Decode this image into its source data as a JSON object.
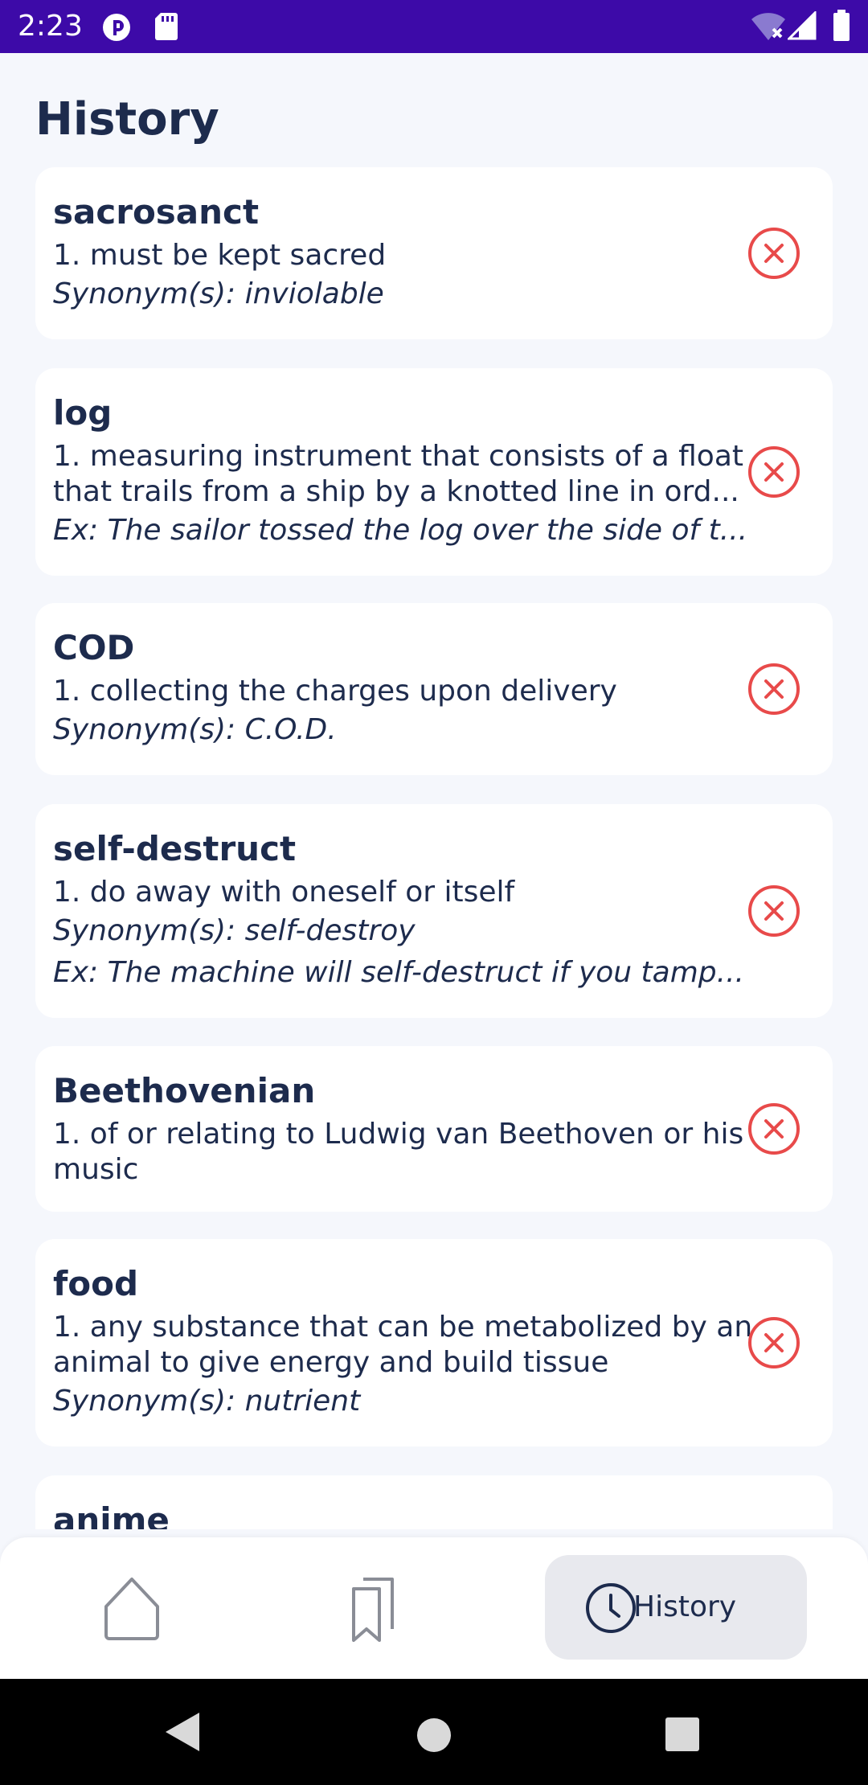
{
  "status_bar": {
    "time": "2:23",
    "icons": [
      "pocket-casts-icon",
      "sd-card-icon",
      "wifi-off-icon",
      "signal-icon",
      "battery-icon"
    ]
  },
  "page": {
    "title": "History"
  },
  "entries": [
    {
      "word": "sacrosanct",
      "definition": "1. must be kept sacred",
      "synonyms": "Synonym(s): inviolable",
      "example": ""
    },
    {
      "word": "log",
      "definition": "1. measuring instrument that consists of a float that trails from a ship by a knotted line in ord...",
      "synonyms": "",
      "example": "Ex: The sailor tossed the log over the side of t..."
    },
    {
      "word": "COD",
      "definition": "1. collecting the charges upon delivery",
      "synonyms": "Synonym(s): C.O.D.",
      "example": ""
    },
    {
      "word": "self-destruct",
      "definition": "1. do away with oneself or itself",
      "synonyms": "Synonym(s): self-destroy",
      "example": "Ex: The machine will self-destruct if you tamp..."
    },
    {
      "word": "Beethovenian",
      "definition": "1. of or relating to Ludwig van Beethoven or his music",
      "synonyms": "",
      "example": ""
    },
    {
      "word": "food",
      "definition": "1. any substance that can be metabolized by an animal to give energy and build tissue",
      "synonyms": "Synonym(s): nutrient",
      "example": ""
    },
    {
      "word": "anime",
      "definition": "",
      "synonyms": "",
      "example": ""
    }
  ],
  "bottom_nav": {
    "items": [
      {
        "icon": "home-icon",
        "label": ""
      },
      {
        "icon": "bookmarks-icon",
        "label": ""
      },
      {
        "icon": "clock-icon",
        "label": "History",
        "active": true
      }
    ]
  },
  "colors": {
    "status_bar": "#3d0aa8",
    "background": "#f5f7fc",
    "text": "#1d2b4d",
    "remove": "#e84a4a",
    "nav_active": "#e8e9ee"
  }
}
